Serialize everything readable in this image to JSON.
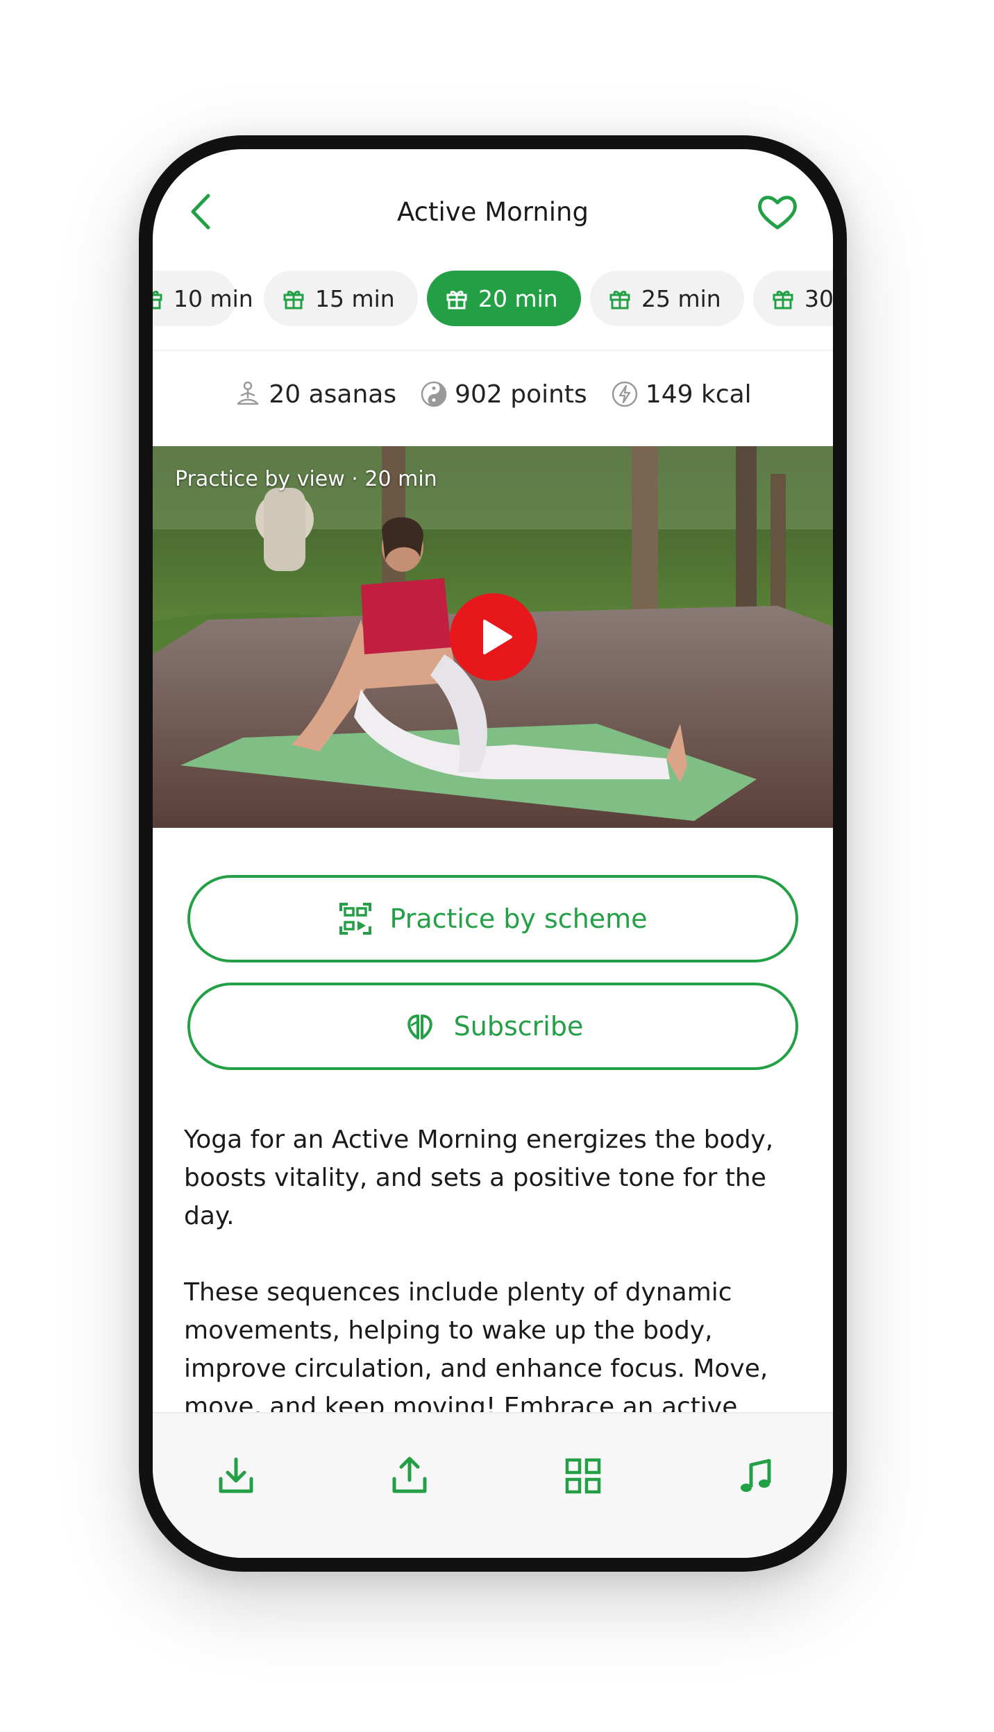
{
  "header": {
    "title": "Active Morning"
  },
  "durations": [
    {
      "label": "10 min",
      "active": false
    },
    {
      "label": "15 min",
      "active": false
    },
    {
      "label": "20 min",
      "active": true
    },
    {
      "label": "25 min",
      "active": false
    },
    {
      "label": "30",
      "active": false
    }
  ],
  "stats": {
    "asanas": "20 asanas",
    "points": "902 points",
    "kcal": "149 kcal"
  },
  "video": {
    "caption": "Practice by view · 20 min"
  },
  "buttons": {
    "scheme": "Practice by scheme",
    "subscribe": "Subscribe"
  },
  "description": {
    "p1": "Yoga for an Active Morning energizes the body, boosts vitality, and sets a positive tone for the day.",
    "p2": "These sequences include plenty of dynamic movements, helping to wake up the body, improve circulation, and enhance focus. Move, move, and keep moving! Embrace an active"
  },
  "icons": {
    "back": "chevron-left-icon",
    "favorite": "heart-icon",
    "chip": "gift-icon",
    "asanas": "meditation-icon",
    "points": "yin-yang-icon",
    "kcal": "lightning-icon",
    "play": "play-icon",
    "scheme": "scheme-icon",
    "subscribe": "subscribe-icon",
    "download": "download-icon",
    "share": "share-icon",
    "grid": "grid-icon",
    "music": "music-icon"
  },
  "colors": {
    "accent": "#23a045",
    "play": "#e8171c"
  }
}
